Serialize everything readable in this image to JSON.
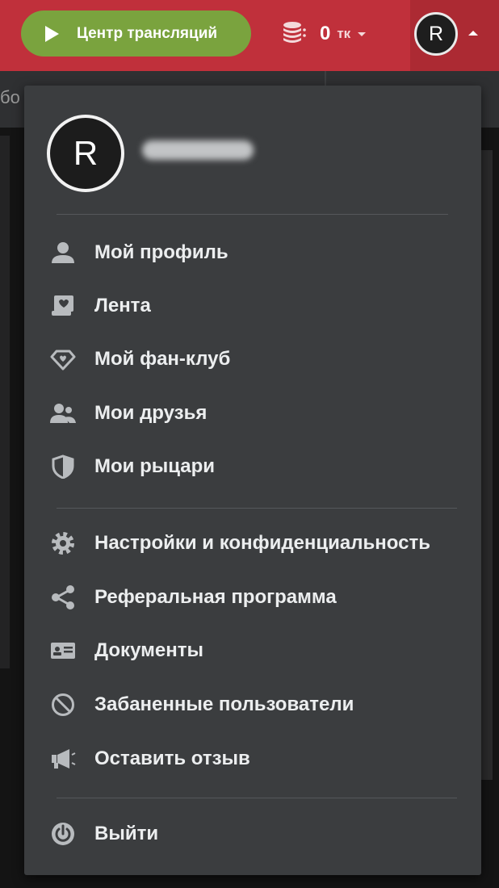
{
  "header": {
    "broadcast_button_label": "Центр трансляций",
    "coins_value": "0",
    "coins_unit": "тк",
    "avatar_initial": "R"
  },
  "background": {
    "subbar_text": "бо"
  },
  "menu": {
    "avatar_initial": "R",
    "items": [
      {
        "label": "Мой профиль",
        "icon": "user-icon"
      },
      {
        "label": "Лента",
        "icon": "feed-icon"
      },
      {
        "label": "Мой фан-клуб",
        "icon": "diamond-heart-icon"
      },
      {
        "label": "Мои друзья",
        "icon": "friends-icon"
      },
      {
        "label": "Мои рыцари",
        "icon": "shield-icon"
      },
      {
        "label": "Настройки и конфиденциальность",
        "icon": "gear-icon"
      },
      {
        "label": "Реферальная программа",
        "icon": "share-icon"
      },
      {
        "label": "Документы",
        "icon": "id-card-icon"
      },
      {
        "label": "Забаненные пользователи",
        "icon": "ban-icon"
      },
      {
        "label": "Оставить отзыв",
        "icon": "megaphone-icon"
      },
      {
        "label": "Выйти",
        "icon": "power-icon"
      }
    ]
  },
  "colors": {
    "topbar": "#c0303b",
    "broadcast_button": "#7aa33e",
    "menu_background": "#3b3d3f",
    "menu_text": "#eceeef",
    "icon": "#b8bbbe"
  }
}
